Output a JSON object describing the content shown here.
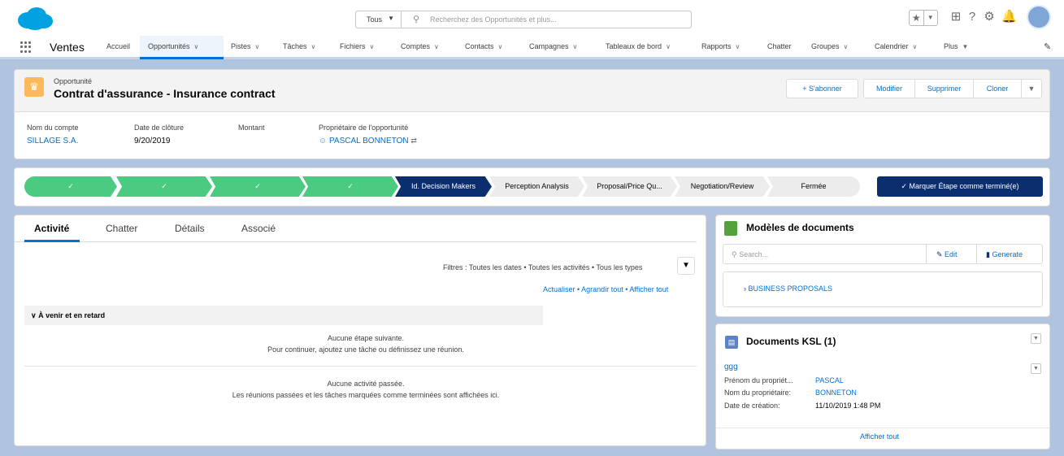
{
  "topbar": {
    "scope": "Tous",
    "search_placeholder": "Recherchez des Opportunités et plus..."
  },
  "nav": {
    "app_name": "Ventes",
    "items": [
      "Accueil",
      "Opportunités",
      "Pistes",
      "Tâches",
      "Fichiers",
      "Comptes",
      "Contacts",
      "Campagnes",
      "Tableaux de bord",
      "Rapports",
      "Chatter",
      "Groupes",
      "Calendrier",
      "Plus"
    ]
  },
  "record": {
    "object_label": "Opportunité",
    "title": "Contrat d'assurance - Insurance contract",
    "buttons": {
      "subscribe": "+ S'abonner",
      "edit": "Modifier",
      "delete": "Supprimer",
      "clone": "Cloner"
    },
    "fields": {
      "account_label": "Nom du compte",
      "account_value": "SILLAGE S.A.",
      "close_date_label": "Date de clôture",
      "close_date_value": "9/20/2019",
      "amount_label": "Montant",
      "owner_label": "Propriétaire de l'opportunité",
      "owner_value": "PASCAL BONNETON"
    }
  },
  "path": {
    "done_mark": "✓",
    "current": "Id. Decision Makers",
    "stages": [
      "Perception Analysis",
      "Proposal/Price Qu...",
      "Negotiation/Review",
      "Fermée"
    ],
    "mark_button": "✓ Marquer Étape comme terminé(e)"
  },
  "activity": {
    "tabs": [
      "Activité",
      "Chatter",
      "Détails",
      "Associé"
    ],
    "filters": "Filtres : Toutes les dates • Toutes les activités • Tous les types",
    "links": "Actualiser • Agrandir tout • Afficher tout",
    "upcoming": "À venir et en retard",
    "next_line1": "Aucune étape suivante.",
    "next_line2": "Pour continuer, ajoutez une tâche ou définissez une réunion.",
    "past_line1": "Aucune activité passée.",
    "past_line2": "Les réunions passées et les tâches marquées comme terminées sont affichées ici."
  },
  "templates": {
    "title": "Modèles de documents",
    "search_placeholder": "Search...",
    "edit": "Edit",
    "generate": "Generate",
    "item": "BUSINESS PROPOSALS"
  },
  "ksl": {
    "title": "Documents KSL (1)",
    "doc_name": "ggg",
    "first_name_label": "Prénom du propriét...",
    "first_name_value": "PASCAL",
    "last_name_label": "Nom du propriétaire:",
    "last_name_value": "BONNETON",
    "created_label": "Date de création:",
    "created_value": "11/10/2019 1:48 PM",
    "show_all": "Afficher tout"
  }
}
